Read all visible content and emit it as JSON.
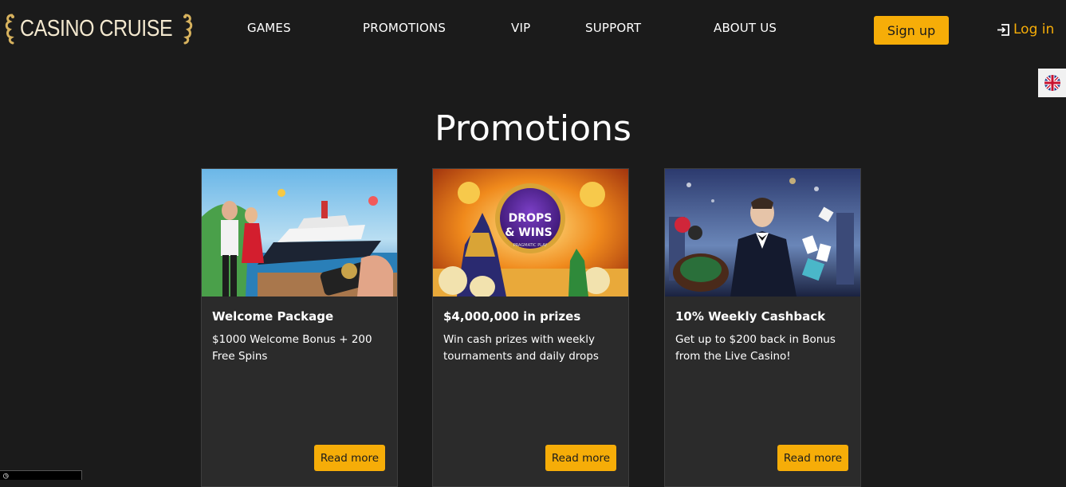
{
  "brand": {
    "logo_text": "CASINO CRUISE",
    "accent_color": "#f6ad08",
    "background_color": "#1b1b1b"
  },
  "nav": {
    "items": [
      {
        "label": "GAMES"
      },
      {
        "label": "PROMOTIONS"
      },
      {
        "label": "VIP"
      },
      {
        "label": "SUPPORT"
      },
      {
        "label": "ABOUT US"
      }
    ],
    "signup_label": "Sign up",
    "login_label": "Log in",
    "language_flag": "uk-flag-icon"
  },
  "page": {
    "title": "Promotions"
  },
  "promotions": [
    {
      "title": "Welcome Package",
      "description": "$1000 Welcome Bonus + 200 Free Spins",
      "button_label": "Read more"
    },
    {
      "title": "$4,000,000 in prizes",
      "description": "Win cash prizes with weekly tournaments and daily drops",
      "button_label": "Read more"
    },
    {
      "title": "10% Weekly Cashback",
      "description": "Get up to $200 back in Bonus from the Live Casino!",
      "button_label": "Read more"
    }
  ],
  "promo_art": {
    "drops_wins_line1": "DROPS",
    "drops_wins_line2": "& WINS",
    "provider_badge": "PRAGMATIC PLAY"
  }
}
